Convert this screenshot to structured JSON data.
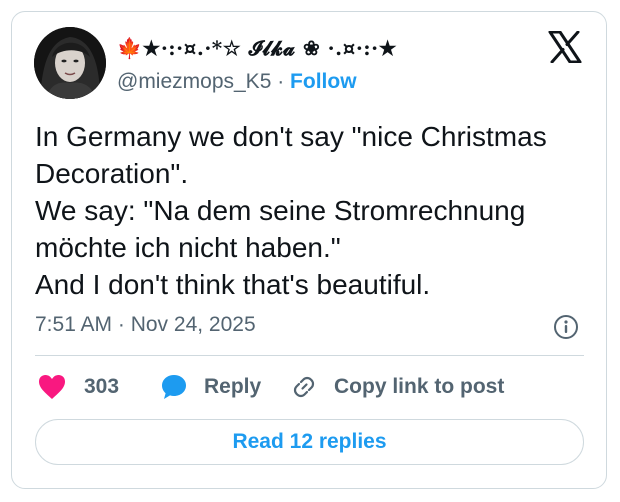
{
  "author": {
    "display_name_prefix": "🍁★·:·¤.·*☆ ",
    "display_name_core": "𝓘𝓵𝓴𝓪",
    "display_name_suffix": " ❀ ·.¤·:·★",
    "handle": "@miezmops_K5",
    "separator": " · ",
    "follow_label": "Follow"
  },
  "tweet": {
    "lines": [
      "In Germany we don't say \"nice Christmas",
      "Decoration\".",
      "We say: \"Na dem seine Stromrechnung",
      "möchte ich nicht haben.\"",
      "And I don't think that's beautiful."
    ],
    "timestamp": "7:51 AM · Nov 24, 2025"
  },
  "actions": {
    "like_count": "303",
    "reply_label": "Reply",
    "copy_label": "Copy link to post"
  },
  "read_replies_label": "Read 12 replies",
  "colors": {
    "accent": "#1d9bf0",
    "like": "#f91880",
    "muted": "#536471",
    "border": "#cfd9de",
    "text": "#0f1419",
    "maple": "#d8232a"
  },
  "icons": [
    "avatar",
    "x-logo-icon",
    "info-icon",
    "heart-icon",
    "speech-bubble-icon",
    "link-icon"
  ]
}
